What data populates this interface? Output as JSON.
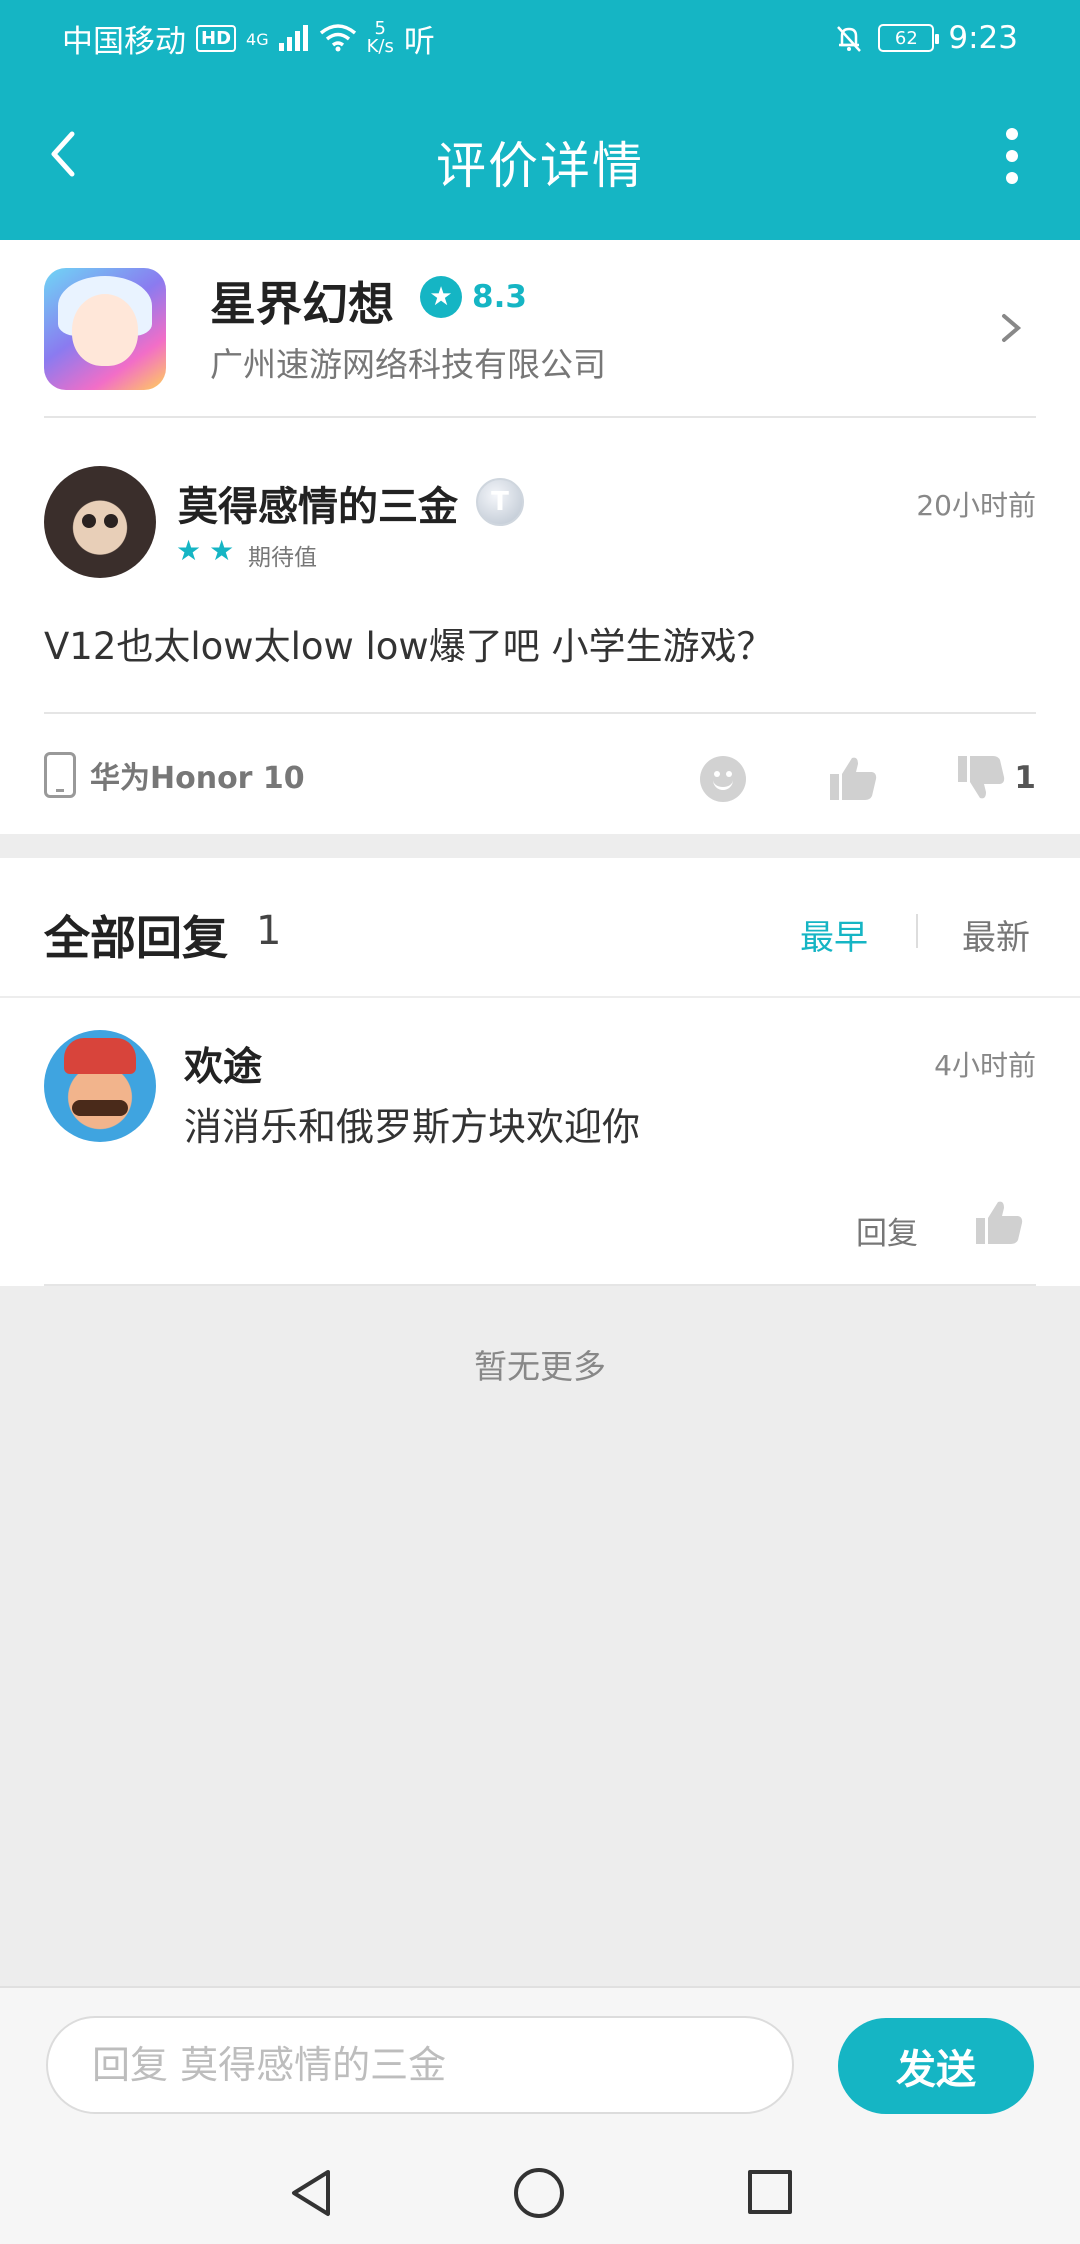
{
  "status_bar": {
    "carrier": "中国移动",
    "hd": "HD",
    "network": "4G",
    "speed_value": "5",
    "speed_unit": "K/s",
    "extra": "听",
    "battery": "62",
    "time": "9:23"
  },
  "app_bar": {
    "title": "评价详情"
  },
  "game": {
    "name": "星界幻想",
    "rating": "8.3",
    "company": "广州速游网络科技有限公司"
  },
  "review": {
    "username": "莫得感情的三金",
    "level_badge": "T",
    "stars_label": "期待值",
    "star_count": 2,
    "time": "20小时前",
    "text": "V12也太low太low low爆了吧 小学生游戏？",
    "device": "华为Honor 10",
    "dislike_count": "1"
  },
  "replies": {
    "title": "全部回复",
    "count": "1",
    "sort_early": "最早",
    "sort_new": "最新",
    "items": [
      {
        "name": "欢途",
        "time": "4小时前",
        "text": "消消乐和俄罗斯方块欢迎你",
        "reply_label": "回复"
      }
    ],
    "no_more": "暂无更多"
  },
  "input": {
    "placeholder": "回复 莫得感情的三金",
    "send_label": "发送"
  },
  "colors": {
    "accent": "#15b5c4",
    "background": "#ededed"
  }
}
